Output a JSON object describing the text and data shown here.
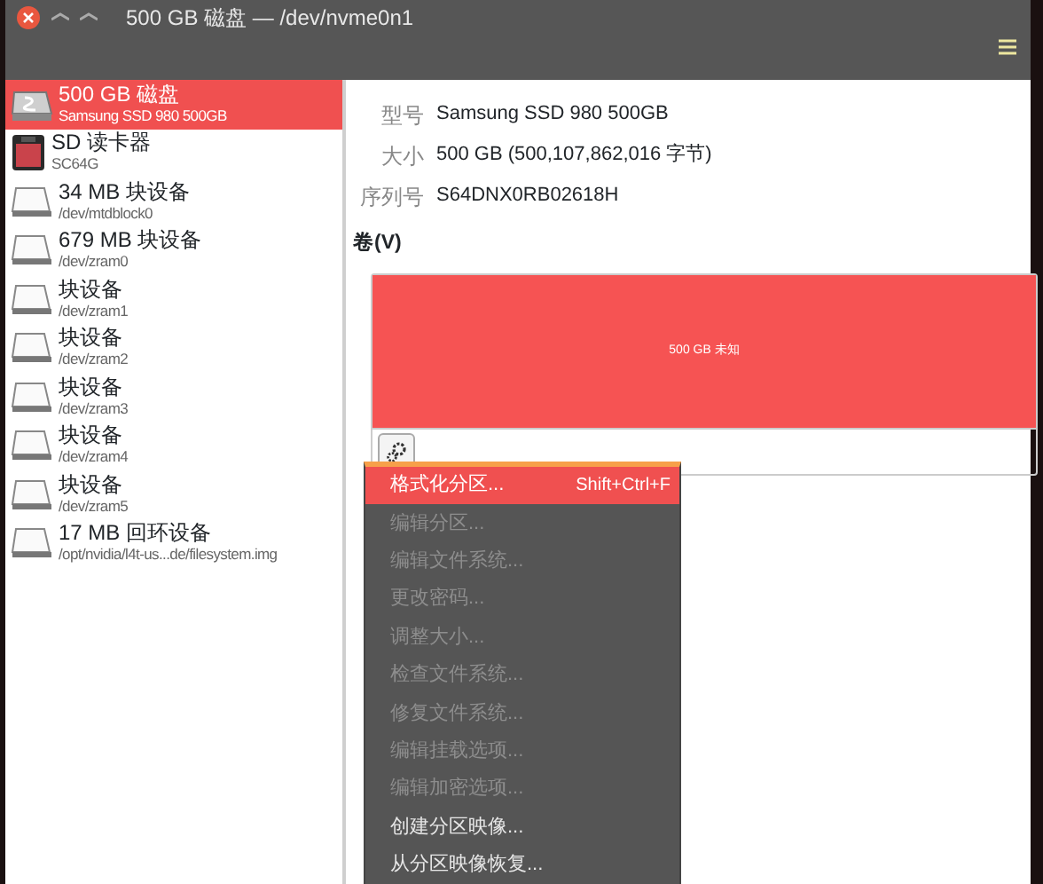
{
  "window": {
    "title": "500 GB 磁盘 — /dev/nvme0n1"
  },
  "sidebar": {
    "items": [
      {
        "kind": "ssd",
        "title": "500 GB 磁盘",
        "subtitle": "Samsung SSD 980 500GB",
        "selected": true
      },
      {
        "kind": "sd",
        "title": "SD 读卡器",
        "subtitle": "SC64G",
        "selected": false
      },
      {
        "kind": "block",
        "title": "34 MB 块设备",
        "subtitle": "/dev/mtdblock0",
        "selected": false
      },
      {
        "kind": "block",
        "title": "679 MB 块设备",
        "subtitle": "/dev/zram0",
        "selected": false
      },
      {
        "kind": "block",
        "title": "块设备",
        "subtitle": "/dev/zram1",
        "selected": false
      },
      {
        "kind": "block",
        "title": "块设备",
        "subtitle": "/dev/zram2",
        "selected": false
      },
      {
        "kind": "block",
        "title": "块设备",
        "subtitle": "/dev/zram3",
        "selected": false
      },
      {
        "kind": "block",
        "title": "块设备",
        "subtitle": "/dev/zram4",
        "selected": false
      },
      {
        "kind": "block",
        "title": "块设备",
        "subtitle": "/dev/zram5",
        "selected": false
      },
      {
        "kind": "block",
        "title": "17 MB 回环设备",
        "subtitle": "/opt/nvidia/l4t-us...de/filesystem.img",
        "selected": false
      }
    ]
  },
  "details": [
    {
      "label": "型号",
      "value": "Samsung SSD 980 500GB"
    },
    {
      "label": "大小",
      "value": "500 GB (500,107,862,016 字节)"
    },
    {
      "label": "序列号",
      "value": "S64DNX0RB02618H"
    }
  ],
  "volumes": {
    "heading": "卷(V)",
    "segment": {
      "label": "500 GB 未知"
    }
  },
  "menu": {
    "items": [
      {
        "label": "格式化分区...",
        "shortcut": "Shift+Ctrl+F",
        "selected": true,
        "disabled": false
      },
      {
        "label": "编辑分区...",
        "selected": false,
        "disabled": true
      },
      {
        "label": "编辑文件系统...",
        "selected": false,
        "disabled": true
      },
      {
        "label": "更改密码...",
        "selected": false,
        "disabled": true
      },
      {
        "label": "调整大小...",
        "selected": false,
        "disabled": true
      },
      {
        "label": "检查文件系统...",
        "selected": false,
        "disabled": true
      },
      {
        "label": "修复文件系统...",
        "selected": false,
        "disabled": true
      },
      {
        "label": "编辑挂载选项...",
        "selected": false,
        "disabled": true
      },
      {
        "label": "编辑加密选项...",
        "selected": false,
        "disabled": true
      },
      {
        "label": "创建分区映像...",
        "selected": false,
        "disabled": false
      },
      {
        "label": "从分区映像恢复...",
        "selected": false,
        "disabled": false
      }
    ]
  }
}
